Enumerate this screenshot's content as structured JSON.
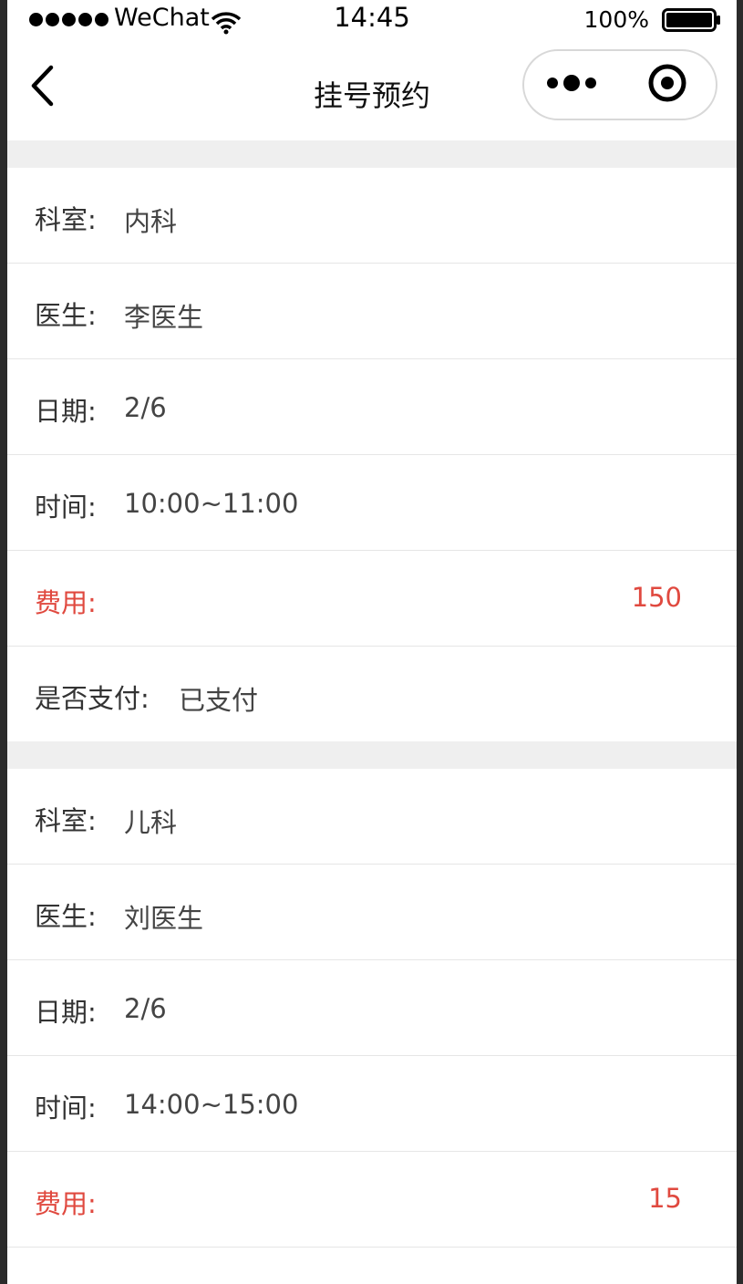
{
  "status_bar": {
    "carrier": "WeChat",
    "time": "14:45",
    "battery": "100%"
  },
  "nav": {
    "title": "挂号预约",
    "back_icon": "chevron-left-icon",
    "more_icon": "more-dots-icon",
    "close_icon": "target-circle-icon"
  },
  "colors": {
    "accent_fee": "#e0493f",
    "section_gap": "#efefef"
  },
  "labels": {
    "department": "科室:",
    "doctor": "医生:",
    "date": "日期:",
    "time": "时间:",
    "fee": "费用:",
    "paid": "是否支付:"
  },
  "appointments": [
    {
      "department": "内科",
      "doctor": "李医生",
      "date": "2/6",
      "time": "10:00~11:00",
      "fee": "150",
      "paid": "已支付"
    },
    {
      "department": "儿科",
      "doctor": "刘医生",
      "date": "2/6",
      "time": "14:00~15:00",
      "fee": "15"
    }
  ]
}
